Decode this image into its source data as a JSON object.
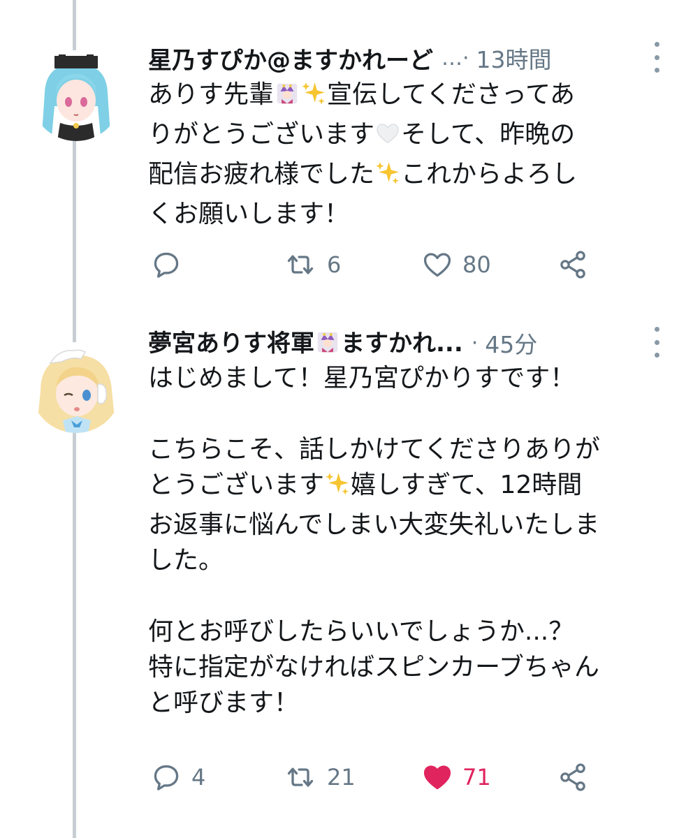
{
  "tweets": [
    {
      "display_name": "星乃すぴか@ますかれーど",
      "separator": "…·",
      "time": "13時間",
      "text": "ありす先輩🃏✨宣伝してくださってありがとうございます🤍そして、昨晩の配信お疲れ様でした✨これからよろしくお願いします！",
      "lines": [
        [
          "ありす先輩",
          "jester",
          "sparkle",
          "宣伝してくださってあ"
        ],
        [
          "りがとうございます",
          "white-heart",
          "そして、昨晩の"
        ],
        [
          "配信お疲れ様でした",
          "sparkle",
          "これからよろし"
        ],
        [
          "くお願いします！"
        ]
      ],
      "actions": {
        "reply": "",
        "retweet": "6",
        "like": "80"
      },
      "liked": false,
      "avatar_icon": "avatar-blue-hair-girl-icon"
    },
    {
      "display_name": "夢宮ありす将軍🃏ますかれ...",
      "separator": "·",
      "time": "45分",
      "lines": [
        [
          "はじめまして！星乃宮ぴかりすです！"
        ],
        [
          ""
        ],
        [
          "こちらこそ、話しかけてくださりありが"
        ],
        [
          "とうございます",
          "sparkle",
          "嬉しすぎて、12時間"
        ],
        [
          "お返事に悩んでしまい大変失礼いたしま"
        ],
        [
          "した。"
        ],
        [
          ""
        ],
        [
          "何とお呼びしたらいいでしょうか...？"
        ],
        [
          "特に指定がなければスピンカーブちゃん"
        ],
        [
          "と呼びます！"
        ]
      ],
      "actions": {
        "reply": "4",
        "retweet": "21",
        "like": "71"
      },
      "liked": true,
      "avatar_icon": "avatar-blonde-maid-girl-icon"
    }
  ],
  "colors": {
    "like_active": "#e0245e",
    "muted": "#657786",
    "thread_line": "#c7ced3"
  }
}
